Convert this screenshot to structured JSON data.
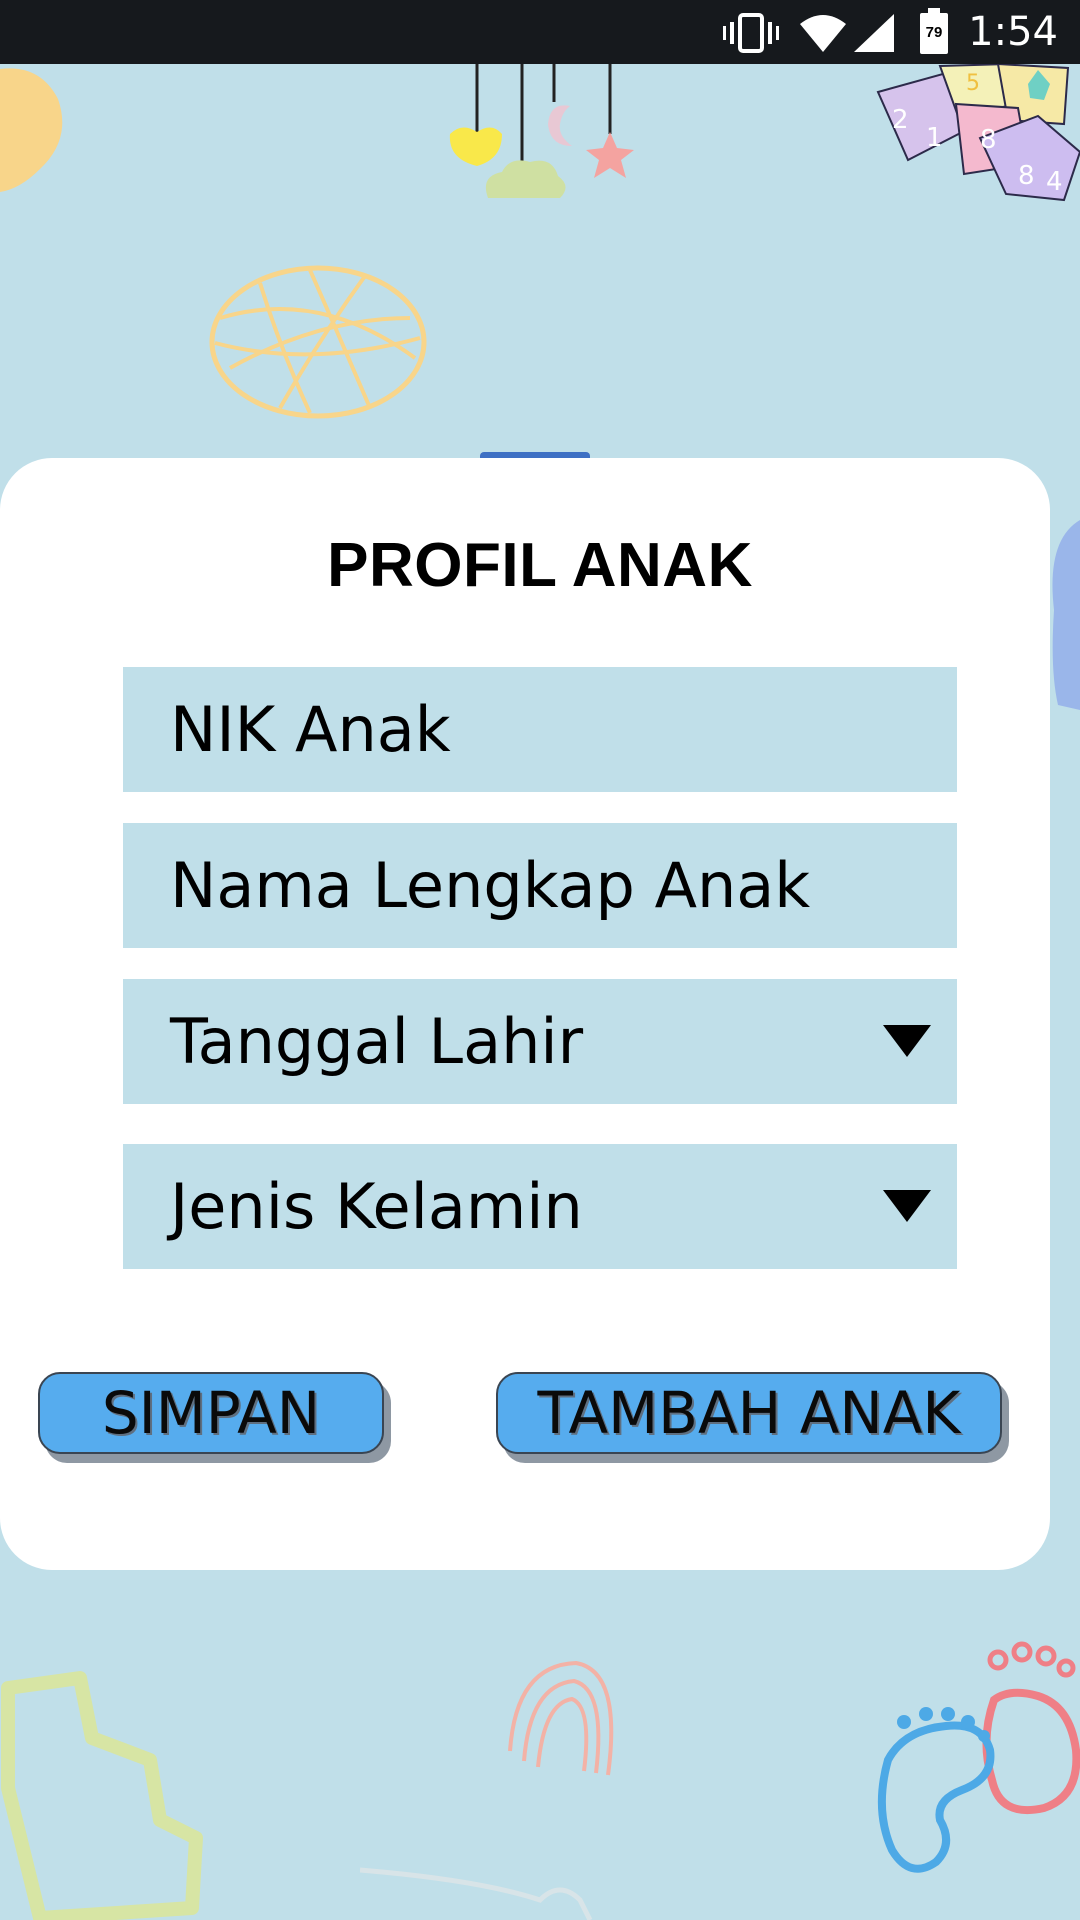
{
  "status_bar": {
    "time": "1:54",
    "battery_level": "79",
    "icons": [
      "vibrate-icon",
      "wifi-icon",
      "signal-icon",
      "battery-icon"
    ]
  },
  "form": {
    "title": "PROFIL ANAK",
    "fields": [
      {
        "placeholder": "NIK Anak",
        "type": "text"
      },
      {
        "placeholder": "Nama Lengkap Anak",
        "type": "text"
      },
      {
        "placeholder": "Tanggal Lahir",
        "type": "dropdown"
      },
      {
        "placeholder": "Jenis Kelamin",
        "type": "dropdown"
      }
    ],
    "buttons": {
      "save": "SIMPAN",
      "add_child": "TAMBAH ANAK"
    }
  },
  "colors": {
    "background": "#c0dfe9",
    "card": "#ffffff",
    "field": "#c0dfe9",
    "button": "#56acee",
    "status_bar": "#16191d"
  },
  "decorations": [
    "orange-blob",
    "crib-mobile",
    "number-blocks",
    "yellow-ball",
    "blue-blob",
    "green-puzzle-piece",
    "rainbow",
    "footprints"
  ]
}
